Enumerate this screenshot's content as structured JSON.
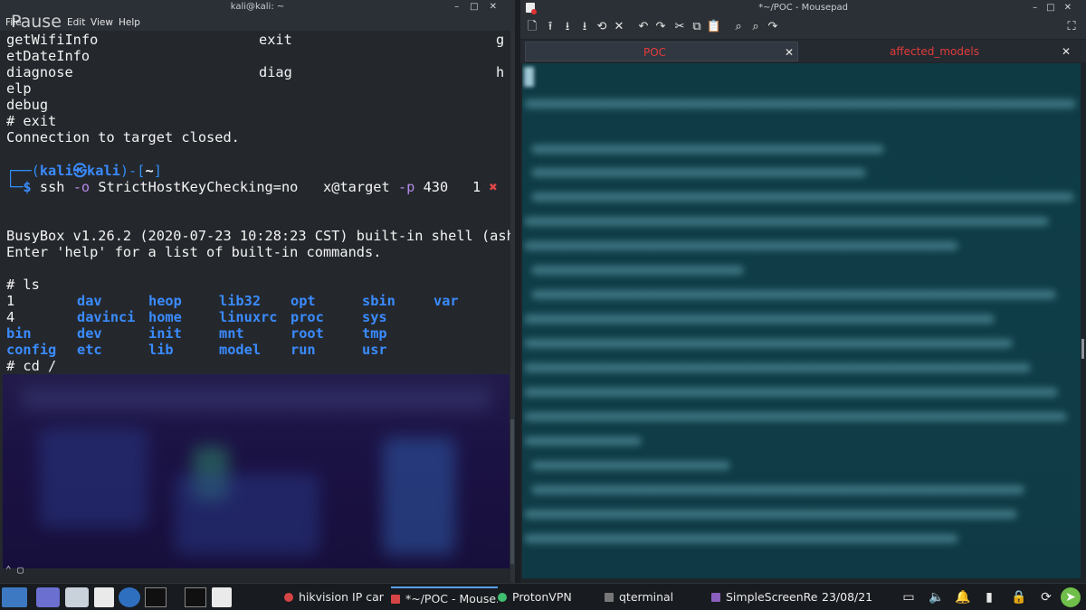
{
  "overlay": {
    "pause_label": "Pause"
  },
  "terminal": {
    "title": "kali@kali: ~",
    "menu": [
      "File",
      "Edit",
      "View",
      "Help"
    ],
    "lines": {
      "l1a": "getWifiInfo",
      "l1b": "exit",
      "l1c": "g",
      "l2": "etDateInfo",
      "l3a": "diagnose",
      "l3b": "diag",
      "l3c": "h",
      "l4": "elp",
      "l5": "debug",
      "l6": "# exit",
      "l7": "Connection to target closed.",
      "prompt_user": "kali",
      "prompt_host": "kali",
      "prompt_dir": "~",
      "cmd_ssh": "ssh",
      "cmd_o": "-o",
      "cmd_opt": "StrictHostKeyChecking=no",
      "cmd_target": "x@target",
      "cmd_p": "-p",
      "cmd_port": "430",
      "exit_code": "1",
      "busybox": "BusyBox v1.26.2 (2020-07-23 10:28:23 CST) built-in shell (ash)",
      "enter_help": "Enter 'help' for a list of built-in commands.",
      "ls_cmd": "# ls",
      "cd_cmd": "# cd /"
    },
    "ls_rows": [
      [
        "1",
        "dav",
        "heop",
        "lib32",
        "opt",
        "sbin",
        "var"
      ],
      [
        "4",
        "davinci",
        "home",
        "linuxrc",
        "proc",
        "sys",
        ""
      ],
      [
        "bin",
        "dev",
        "init",
        "mnt",
        "root",
        "tmp",
        ""
      ],
      [
        "config",
        "etc",
        "lib",
        "model",
        "run",
        "usr",
        ""
      ]
    ]
  },
  "mousepad": {
    "title": "*~/POC - Mousepad",
    "tabs": [
      {
        "label": "POC",
        "active": true
      },
      {
        "label": "affected_models",
        "active": false
      }
    ]
  },
  "taskbar": {
    "tasks": [
      "hikvision IP cam...",
      "*~/POC - Mouse...",
      "ProtonVPN",
      "qterminal",
      "SimpleScreenRe..."
    ],
    "clock": "23/08/21"
  },
  "colors": {
    "accent_blue": "#2f8df7",
    "error_red": "#e04848",
    "tab_red": "#e23b3b",
    "editor_bg": "#0f3d47"
  }
}
